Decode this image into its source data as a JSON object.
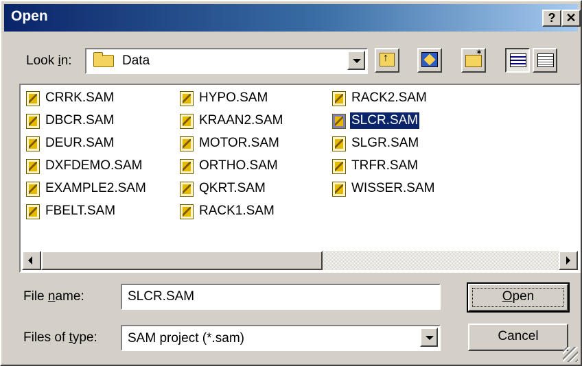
{
  "window": {
    "title": "Open",
    "help_glyph": "?",
    "close_glyph": "✕"
  },
  "look_in": {
    "label_pre": "Look ",
    "label_key": "i",
    "label_post": "n:",
    "value": "Data",
    "icon": "folder-icon"
  },
  "toolbar": {
    "icons": [
      "up-one-level-icon",
      "desktop-icon",
      "new-folder-icon",
      "list-view-icon",
      "details-view-icon"
    ],
    "active_view": "list"
  },
  "files": {
    "columns": [
      [
        "CRRK.SAM",
        "DBCR.SAM",
        "DEUR.SAM",
        "DXFDEMO.SAM",
        "EXAMPLE2.SAM",
        "FBELT.SAM"
      ],
      [
        "HYPO.SAM",
        "KRAAN2.SAM",
        "MOTOR.SAM",
        "ORTHO.SAM",
        "QKRT.SAM",
        "RACK1.SAM"
      ],
      [
        "RACK2.SAM",
        "SLCR.SAM",
        "SLGR.SAM",
        "TRFR.SAM",
        "WISSER.SAM"
      ]
    ],
    "selected": "SLCR.SAM"
  },
  "file_name": {
    "label_pre": "File ",
    "label_key": "n",
    "label_post": "ame:",
    "value": "SLCR.SAM"
  },
  "file_type": {
    "label_pre": "Files of ",
    "label_key": "t",
    "label_post": "ype:",
    "value": "SAM project (*.sam)"
  },
  "buttons": {
    "open_key": "O",
    "open_rest": "pen",
    "cancel": "Cancel"
  },
  "colors": {
    "title_start": "#0a246a",
    "title_end": "#a6caf0",
    "face": "#d4d0c8",
    "selection": "#0a246a"
  }
}
